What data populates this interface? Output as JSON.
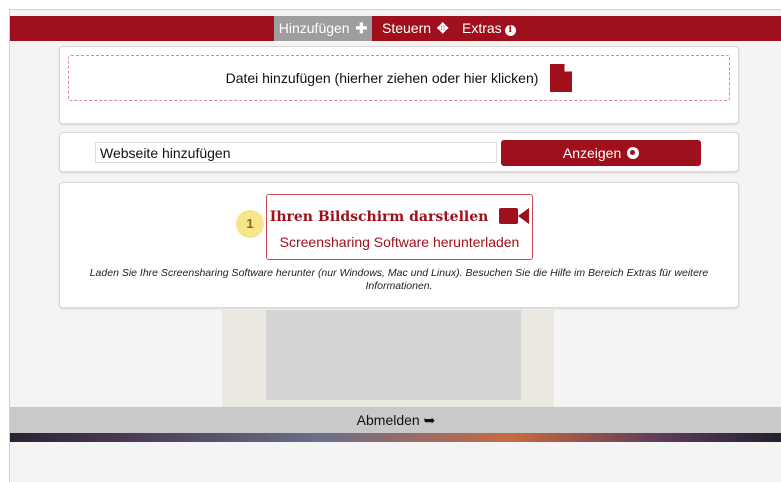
{
  "nav": {
    "add_label": "Hinzufügen",
    "control_label": "Steuern",
    "extras_label": "Extras",
    "icons": [
      "plus-icon",
      "move-arrows-icon",
      "info-icon"
    ]
  },
  "file_upload": {
    "label": "Datei hinzufügen (hierher ziehen oder hier klicken)",
    "icon": "file-icon"
  },
  "website": {
    "input_value": "Webseite hinzufügen",
    "button_label": "Anzeigen",
    "button_icon": "globe-icon"
  },
  "screenshare": {
    "step_number": "1",
    "title": "Ihren Bildschirm darstellen",
    "subtitle": "Screensharing Software herunterladen",
    "icon": "video-camera-icon",
    "description": "Laden Sie Ihre Screensharing Software herunter (nur Windows, Mac und Linux). Besuchen Sie die Hilfe im Bereich Extras für weitere Informationen."
  },
  "footer": {
    "logout_label": "Abmelden",
    "logout_icon": "sign-out-icon"
  },
  "colors": {
    "brand_red": "#a0101c",
    "active_tab_gray": "#9e9e9e",
    "badge_yellow": "#f7e58a"
  }
}
